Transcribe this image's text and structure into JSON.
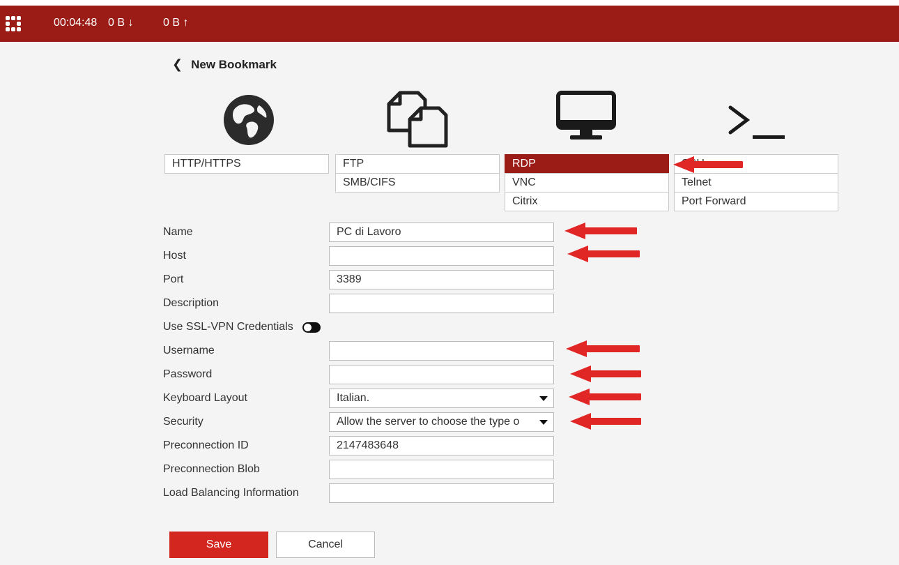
{
  "topbar": {
    "logo_icon": "fortinet-logo-icon",
    "session_time": "00:04:48",
    "download": "0 B ↓",
    "upload": "0 B ↑",
    "color": "#9b1c16"
  },
  "header": {
    "back_icon": "chevron-left-icon",
    "title": "New Bookmark"
  },
  "bookmark_types": [
    {
      "icon": "globe-icon",
      "options": [
        "HTTP/HTTPS"
      ]
    },
    {
      "icon": "files-icon",
      "options": [
        "FTP",
        "SMB/CIFS"
      ]
    },
    {
      "icon": "monitor-icon",
      "options": [
        "RDP",
        "VNC",
        "Citrix"
      ],
      "selected": "RDP"
    },
    {
      "icon": "terminal-icon",
      "options": [
        "SSH",
        "Telnet",
        "Port Forward"
      ]
    }
  ],
  "form": {
    "name": {
      "label": "Name",
      "value": "PC di Lavoro"
    },
    "host": {
      "label": "Host",
      "value": ""
    },
    "port": {
      "label": "Port",
      "value": "3389"
    },
    "description": {
      "label": "Description",
      "value": ""
    },
    "ssl_credentials": {
      "label": "Use SSL-VPN Credentials",
      "enabled": false
    },
    "username": {
      "label": "Username",
      "value": ""
    },
    "password": {
      "label": "Password",
      "value": ""
    },
    "keyboard_layout": {
      "label": "Keyboard Layout",
      "value": "Italian."
    },
    "security": {
      "label": "Security",
      "value": "Allow the server to choose the type o"
    },
    "preconnection_id": {
      "label": "Preconnection ID",
      "value": "2147483648"
    },
    "preconnection_blob": {
      "label": "Preconnection Blob",
      "value": ""
    },
    "load_balancing": {
      "label": "Load Balancing Information",
      "value": ""
    }
  },
  "buttons": {
    "save": "Save",
    "cancel": "Cancel"
  },
  "accent_color": "#d3261f",
  "annotation_arrow_color": "#e12626"
}
